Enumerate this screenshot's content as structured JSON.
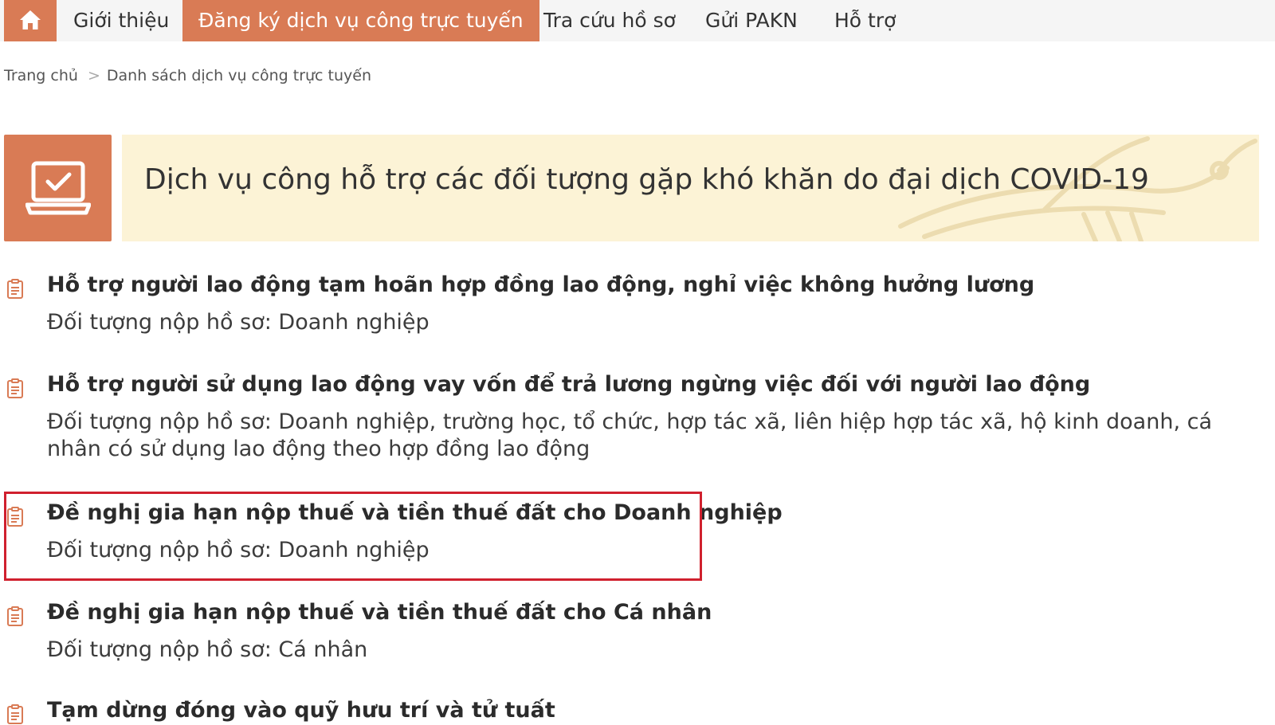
{
  "nav": {
    "home_icon": "home-icon",
    "items": [
      {
        "label": "Giới thiệu"
      },
      {
        "label": "Đăng ký dịch vụ công trực tuyến",
        "active": true
      },
      {
        "label": "Tra cứu hồ sơ"
      },
      {
        "label": "Gửi PAKN"
      },
      {
        "label": "Hỗ trợ"
      }
    ]
  },
  "breadcrumb": {
    "home": "Trang chủ",
    "separator": ">",
    "current": "Danh sách dịch vụ công trực tuyến"
  },
  "banner": {
    "icon": "laptop-check-icon",
    "title": "Dịch vụ công hỗ trợ các đối tượng gặp khó khăn do đại dịch COVID-19"
  },
  "services": [
    {
      "title": "Hỗ trợ người lao động tạm hoãn hợp đồng lao động, nghỉ việc không hưởng lương",
      "subtitle": "Đối tượng nộp hồ sơ: Doanh nghiệp"
    },
    {
      "title": "Hỗ trợ người sử dụng lao động vay vốn để trả lương ngừng việc đối với người lao động",
      "subtitle": "Đối tượng nộp hồ sơ: Doanh nghiệp, trường học, tổ chức, hợp tác xã, liên hiệp hợp tác xã, hộ kinh doanh, cá nhân có sử dụng lao động theo hợp đồng lao động"
    },
    {
      "title": "Đề nghị gia hạn nộp thuế và tiền thuế đất cho Doanh nghiệp",
      "subtitle": "Đối tượng nộp hồ sơ: Doanh nghiệp",
      "highlighted": true
    },
    {
      "title": "Đề nghị gia hạn nộp thuế và tiền thuế đất cho Cá nhân",
      "subtitle": "Đối tượng nộp hồ sơ: Cá nhân"
    },
    {
      "title": "Tạm dừng đóng vào quỹ hưu trí và tử tuất",
      "subtitle": ""
    }
  ],
  "colors": {
    "accent": "#d97b55",
    "banner_bg": "#fcf3d6",
    "nav_bg": "#f5f5f5",
    "highlight_border": "#d0202e"
  }
}
